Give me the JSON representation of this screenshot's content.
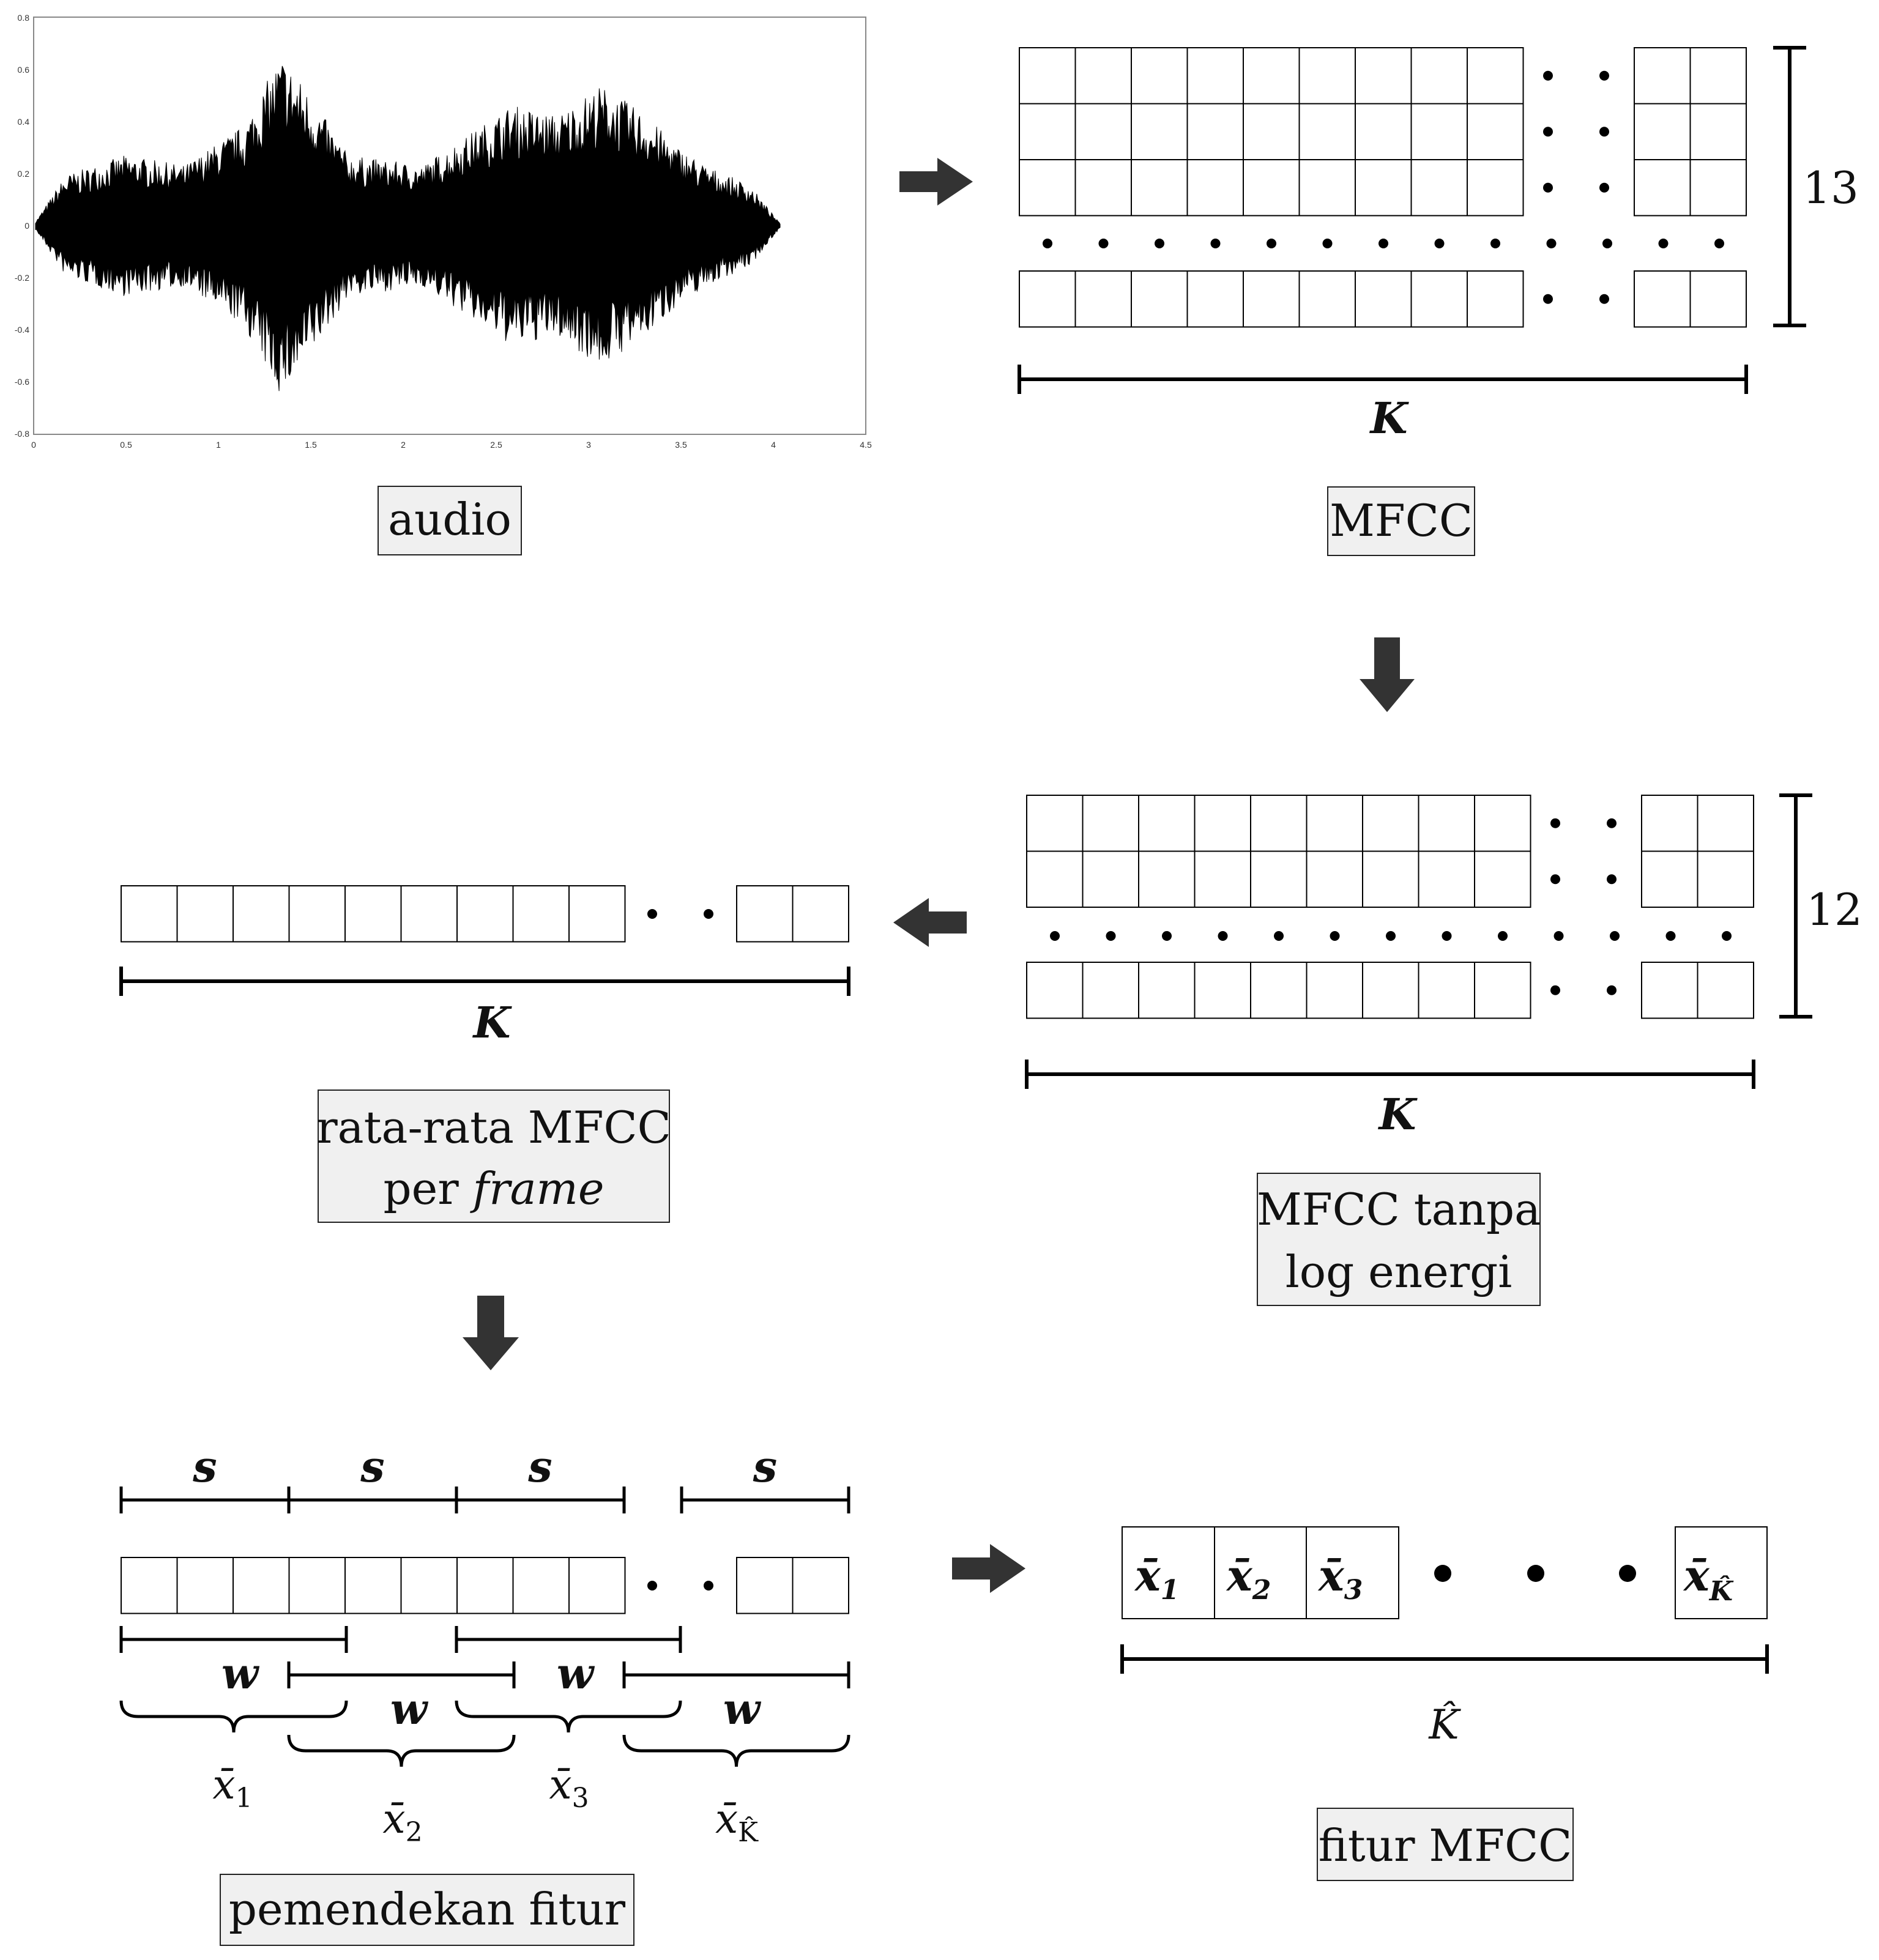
{
  "stages": {
    "audio": {
      "label": "audio"
    },
    "mfcc": {
      "label": "MFCC",
      "rows_label": "13",
      "cols_label": "K"
    },
    "mfcc_no_log": {
      "label_line1": "MFCC tanpa",
      "label_line2": "log energi",
      "rows_label": "12",
      "cols_label": "K"
    },
    "avg": {
      "label_line1": "rata-rata MFCC",
      "label_line2_prefix": "per ",
      "label_line2_italic": "frame",
      "cols_label": "K"
    },
    "shorten": {
      "label": "pemendekan fitur",
      "step_label": "s",
      "window_label": "w"
    },
    "feature": {
      "label": "fitur MFCC",
      "length_label": "K̂"
    }
  },
  "waveform_axis": {
    "x_ticks": [
      "0",
      "0.5",
      "1",
      "1.5",
      "2",
      "2.5",
      "3",
      "3.5",
      "4",
      "4.5"
    ],
    "y_ticks": [
      "0.8",
      "0.6",
      "0.4",
      "0.2",
      "0",
      "-0.2",
      "-0.4",
      "-0.6",
      "-0.8"
    ]
  },
  "feature_vector": {
    "symbols": [
      "x̄",
      "x̄",
      "x̄",
      "x̄"
    ],
    "subscripts": [
      "1",
      "2",
      "3",
      "K̂"
    ]
  },
  "colors": {
    "arrow": "#333333",
    "label_box": "#f0f0f0",
    "line": "#000000"
  }
}
